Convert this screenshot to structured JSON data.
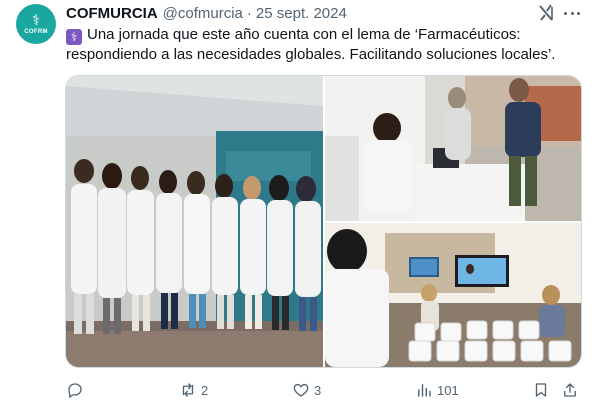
{
  "colors": {
    "accent": "#1d9bf0",
    "text_primary": "#0f1419",
    "text_secondary": "#536471",
    "avatar_bg": "#1aa7a0"
  },
  "author": {
    "display_name": "COFMURCIA",
    "handle": "@cofmurcia",
    "separator": "·",
    "date": "25 sept. 2024",
    "avatar_text": "COFRM"
  },
  "tweet": {
    "emoji_icon": "caduceus-emoji-icon",
    "text": "Una jornada que este año cuenta con el lema de ‘Farmacéuticos: respondiendo a las necesidades globales. Facilitando soluciones locales’."
  },
  "media": {
    "photos": [
      {
        "subject": "group-of-pharmacists-photo"
      },
      {
        "subject": "health-screening-booth-photo"
      },
      {
        "subject": "lecture-room-with-screens-photo"
      }
    ]
  },
  "actions": {
    "reply": {
      "icon": "reply-icon",
      "count": ""
    },
    "retweet": {
      "icon": "retweet-icon",
      "count": "2"
    },
    "like": {
      "icon": "heart-icon",
      "count": "3"
    },
    "views": {
      "icon": "views-chart-icon",
      "count": "101"
    },
    "bookmark": {
      "icon": "bookmark-icon"
    },
    "share": {
      "icon": "share-icon"
    }
  }
}
